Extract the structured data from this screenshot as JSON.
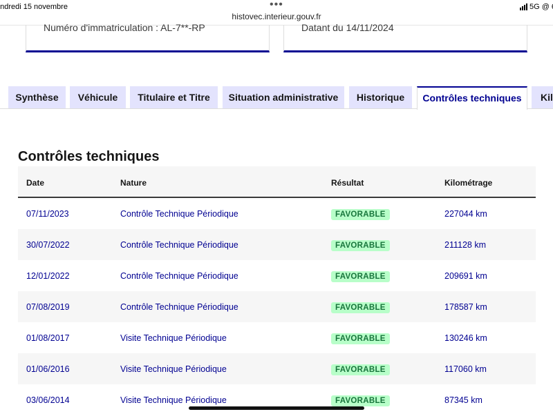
{
  "status_bar": {
    "date": "endredi 15 novembre",
    "dots": "•••",
    "network": "5G",
    "battery_partial": "6"
  },
  "browser": {
    "url": "histovec.interieur.gouv.fr"
  },
  "cards": {
    "left_text": "Numéro d'immatriculation : AL-7**-RP",
    "right_text": "Datant du 14/11/2024"
  },
  "tabs": [
    {
      "label": "Synthèse",
      "active": false
    },
    {
      "label": "Véhicule",
      "active": false
    },
    {
      "label": "Titulaire et Titre",
      "active": false
    },
    {
      "label": "Situation administrative",
      "active": false
    },
    {
      "label": "Historique",
      "active": false
    },
    {
      "label": "Contrôles techniques",
      "active": true
    },
    {
      "label": "Kilo",
      "active": false
    }
  ],
  "section": {
    "title": "Contrôles techniques"
  },
  "table": {
    "headers": {
      "date": "Date",
      "nature": "Nature",
      "result": "Résultat",
      "km": "Kilométrage"
    },
    "rows": [
      {
        "date": "07/11/2023",
        "nature": "Contrôle Technique Périodique",
        "result": "FAVORABLE",
        "km": "227044 km"
      },
      {
        "date": "30/07/2022",
        "nature": "Contrôle Technique Périodique",
        "result": "FAVORABLE",
        "km": "211128 km"
      },
      {
        "date": "12/01/2022",
        "nature": "Contrôle Technique Périodique",
        "result": "FAVORABLE",
        "km": "209691 km"
      },
      {
        "date": "07/08/2019",
        "nature": "Contrôle Technique Périodique",
        "result": "FAVORABLE",
        "km": "178587 km"
      },
      {
        "date": "01/08/2017",
        "nature": "Visite Technique Périodique",
        "result": "FAVORABLE",
        "km": "130246 km"
      },
      {
        "date": "01/06/2016",
        "nature": "Visite Technique Périodique",
        "result": "FAVORABLE",
        "km": "117060 km"
      },
      {
        "date": "03/06/2014",
        "nature": "Visite Technique Périodique",
        "result": "FAVORABLE",
        "km": "87345 km"
      }
    ]
  },
  "colors": {
    "brand_blue": "#000091",
    "tab_bg": "#e3e3fd",
    "badge_bg": "#b8fec9",
    "badge_text": "#18753c"
  }
}
